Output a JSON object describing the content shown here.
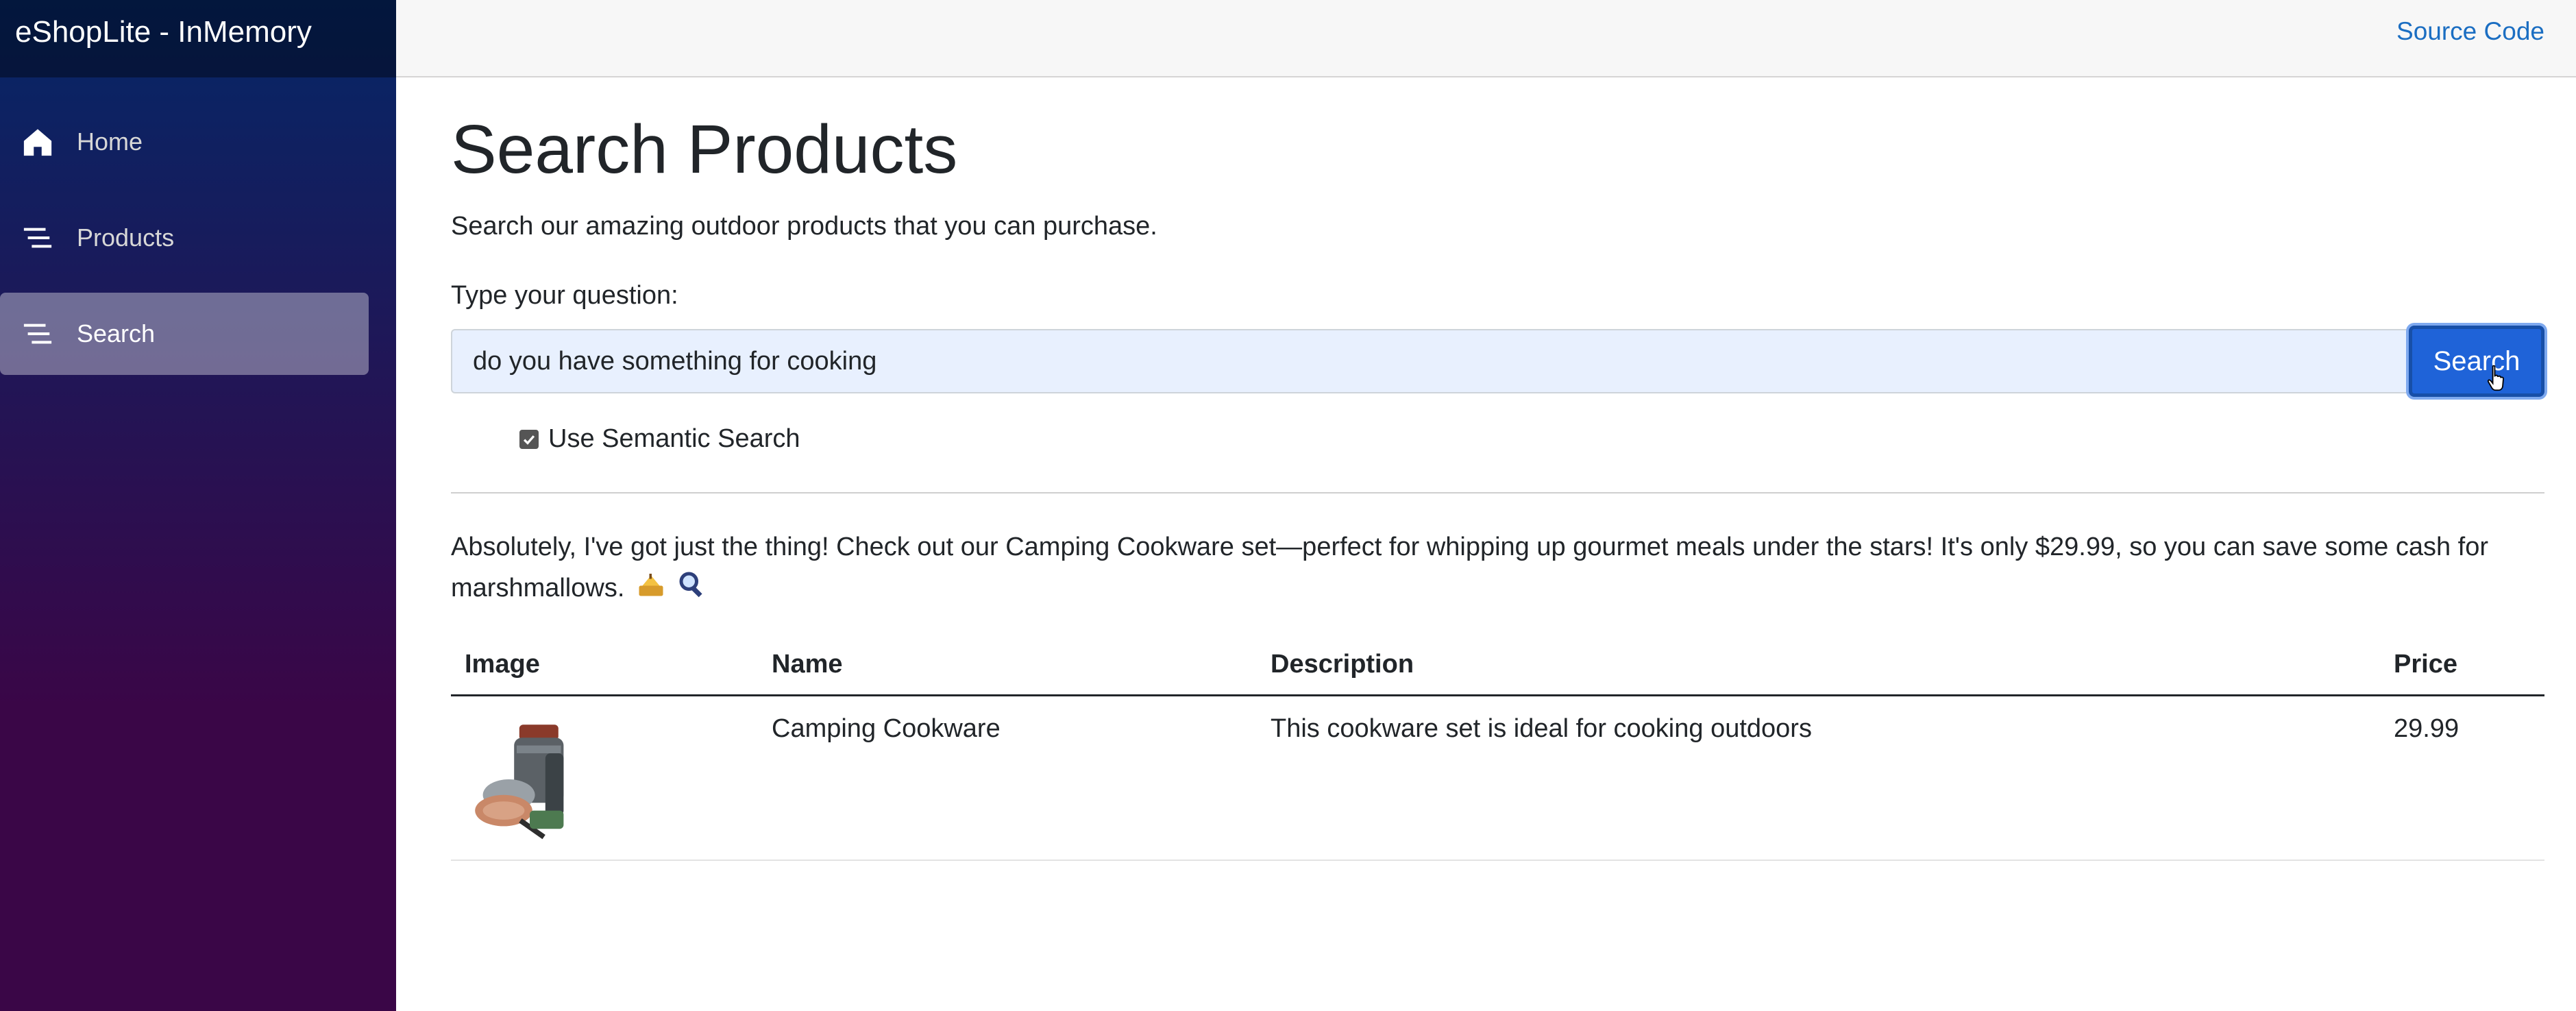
{
  "sidebar": {
    "brand": "eShopLite - InMemory",
    "items": [
      {
        "label": "Home",
        "icon": "home-icon",
        "active": false
      },
      {
        "label": "Products",
        "icon": "list-icon",
        "active": false
      },
      {
        "label": "Search",
        "icon": "list-icon",
        "active": true
      }
    ]
  },
  "topbar": {
    "source_link": "Source Code"
  },
  "page": {
    "title": "Search Products",
    "subtitle": "Search our amazing outdoor products that you can purchase.",
    "question_label": "Type your question:",
    "search_value": "do you have something for cooking",
    "search_button": "Search",
    "semantic_label": "Use Semantic Search",
    "semantic_checked": true,
    "answer": "Absolutely, I've got just the thing! Check out our Camping Cookware set—perfect for whipping up gourmet meals under the stars! It's only $29.99, so you can save some cash for marshmallows."
  },
  "table": {
    "headers": [
      "Image",
      "Name",
      "Description",
      "Price"
    ],
    "rows": [
      {
        "image": "camping-cookware-image",
        "name": "Camping Cookware",
        "description": "This cookware set is ideal for cooking outdoors",
        "price": "29.99"
      }
    ]
  },
  "colors": {
    "accent": "#1f63d8",
    "link": "#1b6ec2",
    "sidebar_top": "#052767",
    "sidebar_bottom": "#3a0647"
  }
}
